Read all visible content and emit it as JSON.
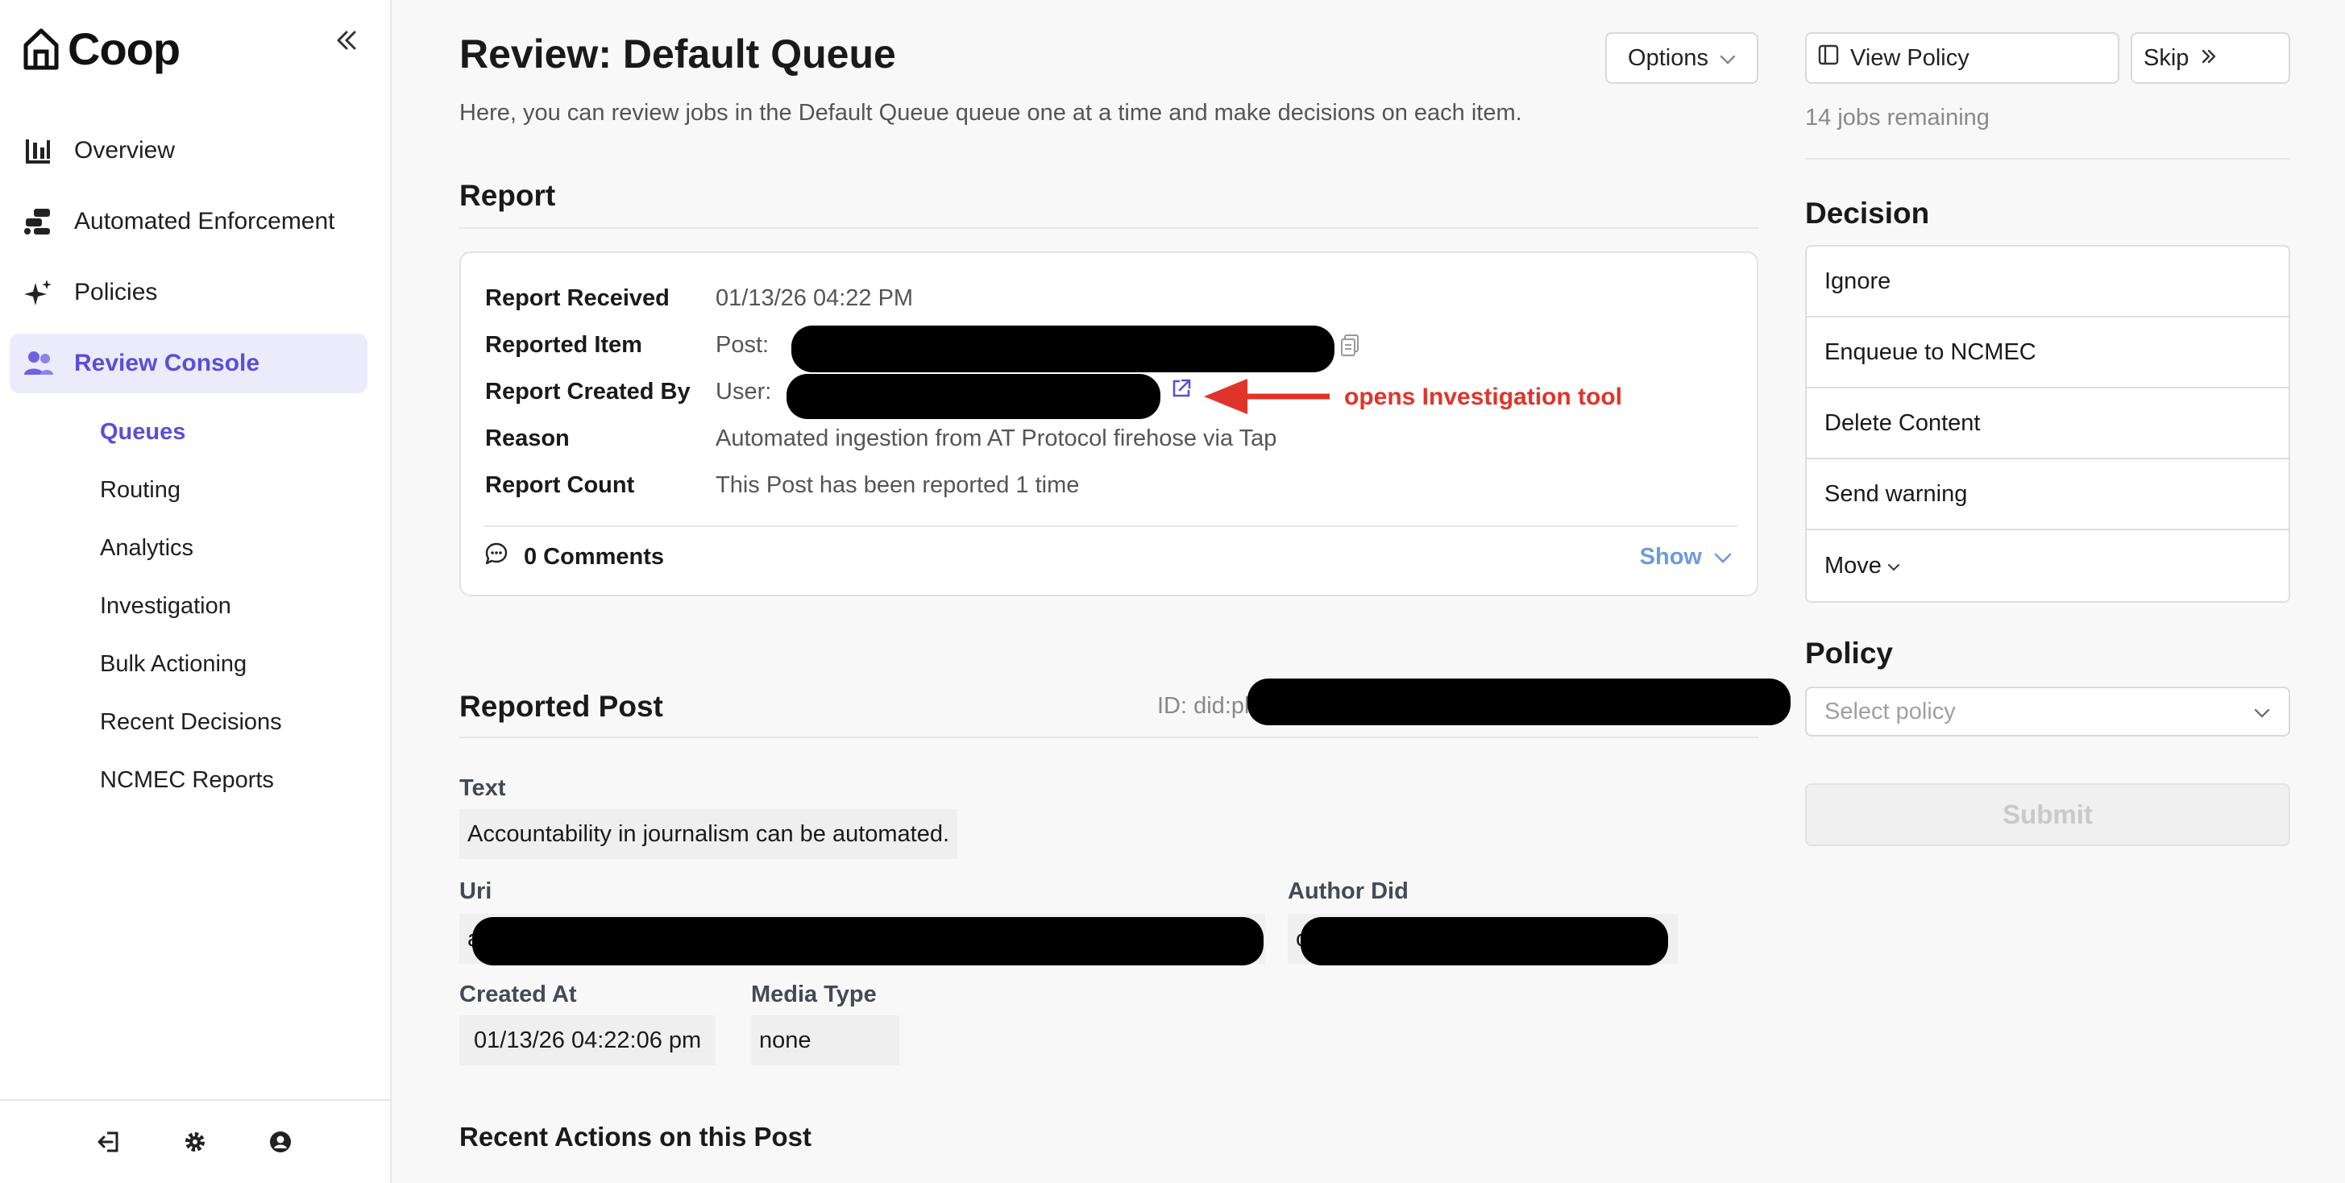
{
  "brand": {
    "name": "Coop"
  },
  "nav": {
    "items": [
      {
        "label": "Overview"
      },
      {
        "label": "Automated Enforcement"
      },
      {
        "label": "Policies"
      },
      {
        "label": "Review Console"
      }
    ],
    "subitems": [
      {
        "label": "Queues"
      },
      {
        "label": "Routing"
      },
      {
        "label": "Analytics"
      },
      {
        "label": "Investigation"
      },
      {
        "label": "Bulk Actioning"
      },
      {
        "label": "Recent Decisions"
      },
      {
        "label": "NCMEC Reports"
      }
    ]
  },
  "header": {
    "title": "Review: Default Queue",
    "subtitle": "Here, you can review jobs in the Default Queue queue one at a time and make decisions on each item.",
    "options_label": "Options"
  },
  "report": {
    "section_title": "Report",
    "fields": [
      {
        "key": "Report Received",
        "value": "01/13/26 04:22 PM"
      },
      {
        "key": "Reported Item",
        "value": "Post:"
      },
      {
        "key": "Report Created By",
        "value": "User:"
      },
      {
        "key": "Reason",
        "value": "Automated ingestion from AT Protocol firehose via Tap"
      },
      {
        "key": "Report Count",
        "value": "This Post has been reported 1 time"
      }
    ],
    "annotation": "opens Investigation tool",
    "comments_label": "0 Comments",
    "show_label": "Show"
  },
  "reported_post": {
    "section_title": "Reported Post",
    "id_prefix": "ID: did:pl",
    "text_label": "Text",
    "text_value": "Accountability in journalism can be automated.",
    "uri_label": "Uri",
    "uri_prefix": "a",
    "author_label": "Author Did",
    "author_prefix": "c",
    "created_label": "Created At",
    "created_value": "01/13/26 04:22:06 pm",
    "media_label": "Media Type",
    "media_value": "none"
  },
  "recent_actions": {
    "title": "Recent Actions on this Post"
  },
  "right_panel": {
    "view_policy_label": "View Policy",
    "skip_label": "Skip",
    "jobs_remaining": "14 jobs remaining",
    "decision_title": "Decision",
    "decisions": [
      {
        "label": "Ignore"
      },
      {
        "label": "Enqueue to NCMEC"
      },
      {
        "label": "Delete Content"
      },
      {
        "label": "Send warning"
      },
      {
        "label": "Move"
      }
    ],
    "policy_title": "Policy",
    "policy_placeholder": "Select policy",
    "submit_label": "Submit"
  },
  "colors": {
    "accent": "#5a4fd6",
    "active_bg": "#ecebfb",
    "link_blue": "#6c9be0",
    "annotation_red": "#e0342a"
  },
  "icons": {
    "brand": "house-icon",
    "collapse": "double-chevron-left-icon",
    "overview": "bar-chart-icon",
    "automated": "workflow-icon",
    "policies": "sparkle-icon",
    "review": "users-icon",
    "footer": [
      "logout-icon",
      "gear-icon",
      "user-circle-icon"
    ]
  }
}
